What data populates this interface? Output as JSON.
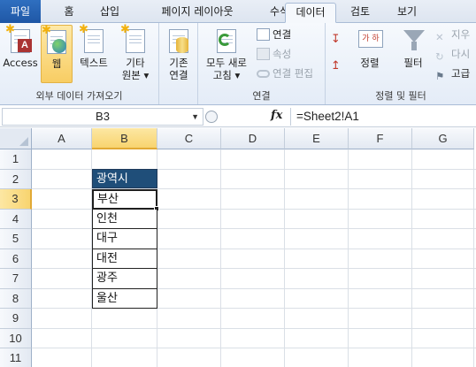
{
  "tabs": [
    {
      "label": "파일",
      "active": false
    },
    {
      "label": "홈",
      "active": false
    },
    {
      "label": "삽입",
      "active": false
    },
    {
      "label": "페이지 레이아웃",
      "active": false
    },
    {
      "label": "수식",
      "active": false
    },
    {
      "label": "데이터",
      "active": true
    },
    {
      "label": "검토",
      "active": false
    },
    {
      "label": "보기",
      "active": false
    }
  ],
  "ribbon": {
    "external": {
      "access": "Access",
      "web": "웹",
      "text": "텍스트",
      "other_line1": "기타",
      "other_line2": "원본",
      "label": "외부 데이터 가져오기"
    },
    "existing": {
      "line1": "기존",
      "line2": "연결"
    },
    "connections": {
      "refresh_line1": "모두 새로",
      "refresh_line2": "고침",
      "connections": "연결",
      "properties": "속성",
      "edit_links": "연결 편집",
      "label": "연결"
    },
    "sort_filter": {
      "sort": "정렬",
      "filter": "필터",
      "clear": "지우",
      "reapply": "다시",
      "advanced": "고급",
      "label": "정렬 및 필터"
    }
  },
  "formula_bar": {
    "name_box": "B3",
    "fx": "fx",
    "formula": "=Sheet2!A1"
  },
  "sheet": {
    "columns": [
      "A",
      "B",
      "C",
      "D",
      "E",
      "F",
      "G"
    ],
    "selected_column": "B",
    "rows": [
      "1",
      "2",
      "3",
      "4",
      "5",
      "6",
      "7",
      "8",
      "9",
      "10",
      "11"
    ],
    "selected_row": "3",
    "header_cell": "광역시",
    "values": [
      "부산",
      "인천",
      "대구",
      "대전",
      "광주",
      "울산"
    ],
    "active_cell": "B3"
  },
  "colors": {
    "header_fill": "#1f4e79",
    "selection_highlight": "#f8d46f",
    "file_tab": "#1f57a6"
  }
}
